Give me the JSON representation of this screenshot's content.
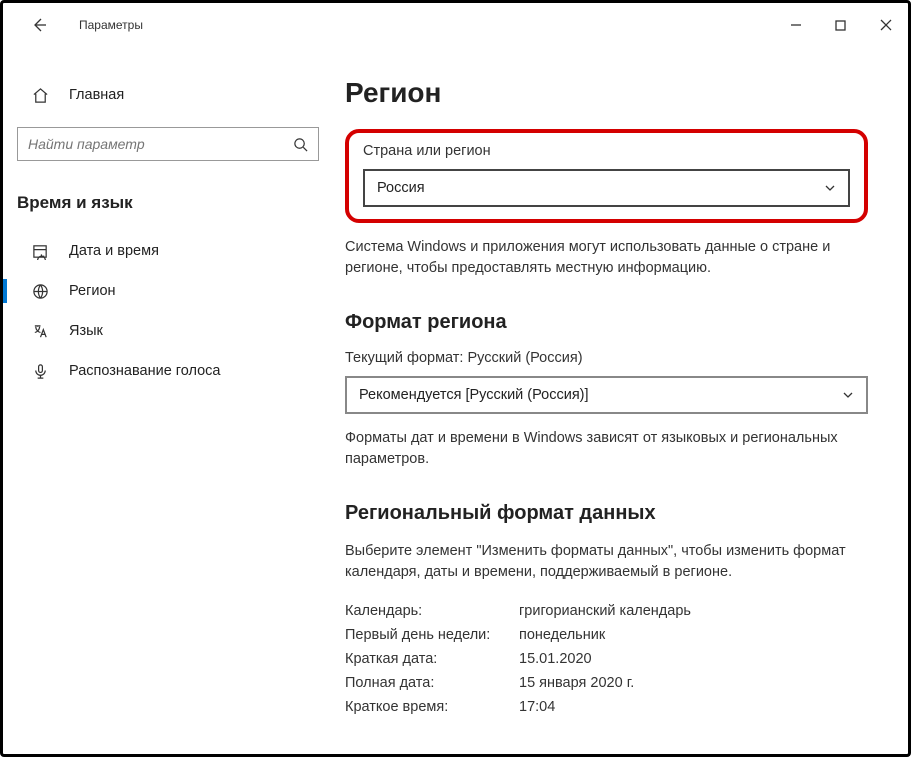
{
  "titlebar": {
    "app_title": "Параметры"
  },
  "sidebar": {
    "home": "Главная",
    "search_placeholder": "Найти параметр",
    "section_heading": "Время и язык",
    "items": [
      {
        "label": "Дата и время"
      },
      {
        "label": "Регион"
      },
      {
        "label": "Язык"
      },
      {
        "label": "Распознавание голоса"
      }
    ]
  },
  "main": {
    "page_title": "Регион",
    "country": {
      "label": "Страна или регион",
      "value": "Россия",
      "help": "Система Windows и приложения могут использовать данные о стране и регионе, чтобы предоставлять местную информацию."
    },
    "region_format_title": "Формат региона",
    "current_format_label": "Текущий формат: Русский (Россия)",
    "format_dropdown": "Рекомендуется [Русский (Россия)]",
    "format_help": "Форматы дат и времени в Windows зависят от языковых и региональных параметров.",
    "regional_data_title": "Региональный формат данных",
    "regional_data_help": "Выберите элемент \"Изменить форматы данных\", чтобы изменить формат календаря, даты и времени, поддерживаемый в регионе.",
    "rows": [
      {
        "key": "Календарь:",
        "val": "григорианский календарь"
      },
      {
        "key": "Первый день недели:",
        "val": "понедельник"
      },
      {
        "key": "Краткая дата:",
        "val": "15.01.2020"
      },
      {
        "key": "Полная дата:",
        "val": "15 января 2020 г."
      },
      {
        "key": "Краткое время:",
        "val": "17:04"
      }
    ]
  }
}
